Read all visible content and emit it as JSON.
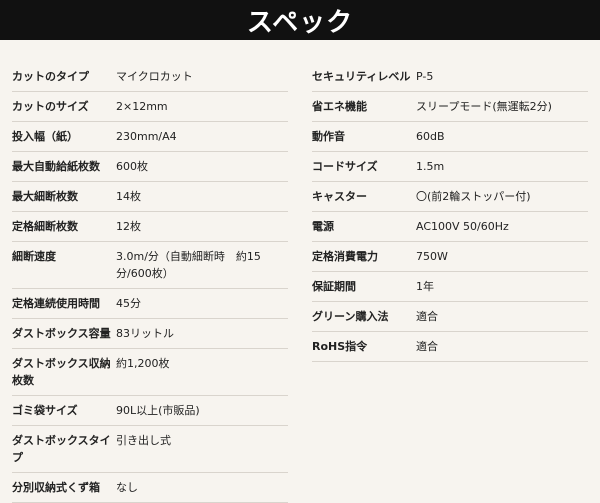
{
  "header": {
    "title": "スペック"
  },
  "left": [
    {
      "label": "カットのタイプ",
      "value": "マイクロカット"
    },
    {
      "label": "カットのサイズ",
      "value": "2×12mm"
    },
    {
      "label": "投入幅（紙）",
      "value": "230mm/A4"
    },
    {
      "label": "最大自動給紙枚数",
      "value": "600枚"
    },
    {
      "label": "最大細断枚数",
      "value": "14枚"
    },
    {
      "label": "定格細断枚数",
      "value": "12枚"
    },
    {
      "label": "細断速度",
      "value": "3.0m/分（自動細断時　約15分/600枚）"
    },
    {
      "label": "定格連続使用時間",
      "value": "45分"
    },
    {
      "label": "ダストボックス容量",
      "value": "83リットル"
    },
    {
      "label": "ダストボックス収納枚数",
      "value": "約1,200枚"
    },
    {
      "label": "ゴミ袋サイズ",
      "value": "90L以上(市販品)"
    },
    {
      "label": "ダストボックスタイプ",
      "value": "引き出し式"
    },
    {
      "label": "分別収納式くず箱",
      "value": "なし"
    }
  ],
  "right": [
    {
      "label": "セキュリティレベル",
      "value": "P-5"
    },
    {
      "label": "省エネ機能",
      "value": "スリープモード(無運転2分)"
    },
    {
      "label": "動作音",
      "value": "60dB"
    },
    {
      "label": "コードサイズ",
      "value": "1.5m"
    },
    {
      "label": "キャスター",
      "value": "〇(前2輪ストッパー付)"
    },
    {
      "label": "電源",
      "value": "AC100V 50/60Hz"
    },
    {
      "label": "定格消費電力",
      "value": "750W"
    },
    {
      "label": "保証期間",
      "value": "1年"
    },
    {
      "label": "グリーン購入法",
      "value": "適合"
    },
    {
      "label": "RoHS指令",
      "value": "適合"
    }
  ]
}
